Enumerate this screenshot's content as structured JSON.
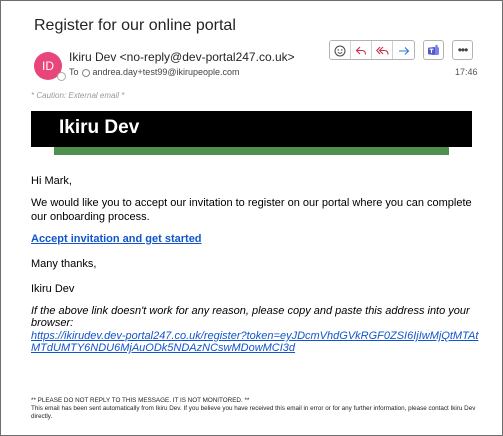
{
  "email": {
    "subject": "Register for our online portal",
    "avatar_initials": "ID",
    "sender": "Ikiru Dev <no-reply@dev-portal247.co.uk>",
    "to_label": "To",
    "recipient": "andrea.day+test99@ikirupeople.com",
    "time": "17:46",
    "caution": "* Caution: External email *"
  },
  "actions": {
    "icons": [
      "emoji-icon",
      "reply-icon",
      "reply-all-icon",
      "forward-icon",
      "teams-icon",
      "more-icon"
    ],
    "more_label": "•••"
  },
  "body": {
    "banner_title": "Ikiru Dev",
    "greeting": "Hi Mark,",
    "invite": "We would like you to accept our invitation to register on our portal where you can complete our onboarding process.",
    "cta": "Accept invitation and get started",
    "thanks": "Many thanks,",
    "signature": "Ikiru Dev",
    "fallback": "If the above link doesn't work for any reason, please copy and paste this address into your browser:",
    "url": "https://ikirudev.dev-portal247.co.uk/register?token=eyJDcmVhdGVkRGF0ZSI6IjIwMjQtMTAtMTdUMTY6NDU6MjAuODk5NDAzNCswMDowMCI3d",
    "footer_notice": "** PLEASE DO NOT REPLY TO THIS MESSAGE. IT IS NOT MONITORED. **",
    "footer_info": "This email has been sent automatically from Ikiru Dev. If you believe you have received this email in error or for any further information, please contact Ikiru Dev directly."
  },
  "colors": {
    "avatar": "#e8457a",
    "accent_icon": "#c4314b",
    "nav_icon": "#2b7cd3",
    "teams": "#5059c9",
    "banner": "#000000",
    "stripe": "#4f8f4f",
    "link": "#1155cc"
  }
}
